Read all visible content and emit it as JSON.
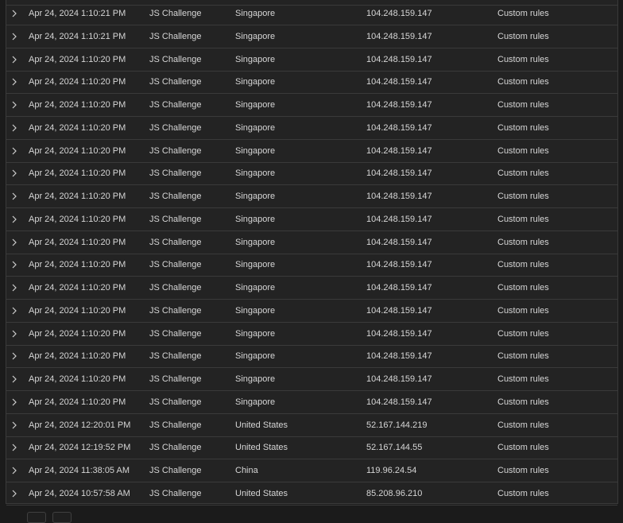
{
  "table": {
    "rows": [
      {
        "date": "Apr 24, 2024 1:10:21 PM",
        "action": "JS Challenge",
        "country": "Singapore",
        "ip": "104.248.159.147",
        "service": "Custom rules"
      },
      {
        "date": "Apr 24, 2024 1:10:21 PM",
        "action": "JS Challenge",
        "country": "Singapore",
        "ip": "104.248.159.147",
        "service": "Custom rules"
      },
      {
        "date": "Apr 24, 2024 1:10:20 PM",
        "action": "JS Challenge",
        "country": "Singapore",
        "ip": "104.248.159.147",
        "service": "Custom rules"
      },
      {
        "date": "Apr 24, 2024 1:10:20 PM",
        "action": "JS Challenge",
        "country": "Singapore",
        "ip": "104.248.159.147",
        "service": "Custom rules"
      },
      {
        "date": "Apr 24, 2024 1:10:20 PM",
        "action": "JS Challenge",
        "country": "Singapore",
        "ip": "104.248.159.147",
        "service": "Custom rules"
      },
      {
        "date": "Apr 24, 2024 1:10:20 PM",
        "action": "JS Challenge",
        "country": "Singapore",
        "ip": "104.248.159.147",
        "service": "Custom rules"
      },
      {
        "date": "Apr 24, 2024 1:10:20 PM",
        "action": "JS Challenge",
        "country": "Singapore",
        "ip": "104.248.159.147",
        "service": "Custom rules"
      },
      {
        "date": "Apr 24, 2024 1:10:20 PM",
        "action": "JS Challenge",
        "country": "Singapore",
        "ip": "104.248.159.147",
        "service": "Custom rules"
      },
      {
        "date": "Apr 24, 2024 1:10:20 PM",
        "action": "JS Challenge",
        "country": "Singapore",
        "ip": "104.248.159.147",
        "service": "Custom rules"
      },
      {
        "date": "Apr 24, 2024 1:10:20 PM",
        "action": "JS Challenge",
        "country": "Singapore",
        "ip": "104.248.159.147",
        "service": "Custom rules"
      },
      {
        "date": "Apr 24, 2024 1:10:20 PM",
        "action": "JS Challenge",
        "country": "Singapore",
        "ip": "104.248.159.147",
        "service": "Custom rules"
      },
      {
        "date": "Apr 24, 2024 1:10:20 PM",
        "action": "JS Challenge",
        "country": "Singapore",
        "ip": "104.248.159.147",
        "service": "Custom rules"
      },
      {
        "date": "Apr 24, 2024 1:10:20 PM",
        "action": "JS Challenge",
        "country": "Singapore",
        "ip": "104.248.159.147",
        "service": "Custom rules"
      },
      {
        "date": "Apr 24, 2024 1:10:20 PM",
        "action": "JS Challenge",
        "country": "Singapore",
        "ip": "104.248.159.147",
        "service": "Custom rules"
      },
      {
        "date": "Apr 24, 2024 1:10:20 PM",
        "action": "JS Challenge",
        "country": "Singapore",
        "ip": "104.248.159.147",
        "service": "Custom rules"
      },
      {
        "date": "Apr 24, 2024 1:10:20 PM",
        "action": "JS Challenge",
        "country": "Singapore",
        "ip": "104.248.159.147",
        "service": "Custom rules"
      },
      {
        "date": "Apr 24, 2024 1:10:20 PM",
        "action": "JS Challenge",
        "country": "Singapore",
        "ip": "104.248.159.147",
        "service": "Custom rules"
      },
      {
        "date": "Apr 24, 2024 1:10:20 PM",
        "action": "JS Challenge",
        "country": "Singapore",
        "ip": "104.248.159.147",
        "service": "Custom rules"
      },
      {
        "date": "Apr 24, 2024 12:20:01 PM",
        "action": "JS Challenge",
        "country": "United States",
        "ip": "52.167.144.219",
        "service": "Custom rules"
      },
      {
        "date": "Apr 24, 2024 12:19:52 PM",
        "action": "JS Challenge",
        "country": "United States",
        "ip": "52.167.144.55",
        "service": "Custom rules"
      },
      {
        "date": "Apr 24, 2024 11:38:05 AM",
        "action": "JS Challenge",
        "country": "China",
        "ip": "119.96.24.54",
        "service": "Custom rules"
      },
      {
        "date": "Apr 24, 2024 10:57:58 AM",
        "action": "JS Challenge",
        "country": "United States",
        "ip": "85.208.96.210",
        "service": "Custom rules"
      }
    ]
  },
  "icons": {
    "row_expand": "chevron-right-icon"
  },
  "colors": {
    "background": "#1b1b1b",
    "panel": "#232323",
    "border": "#3a3a3a",
    "text": "#d6d6d6"
  }
}
